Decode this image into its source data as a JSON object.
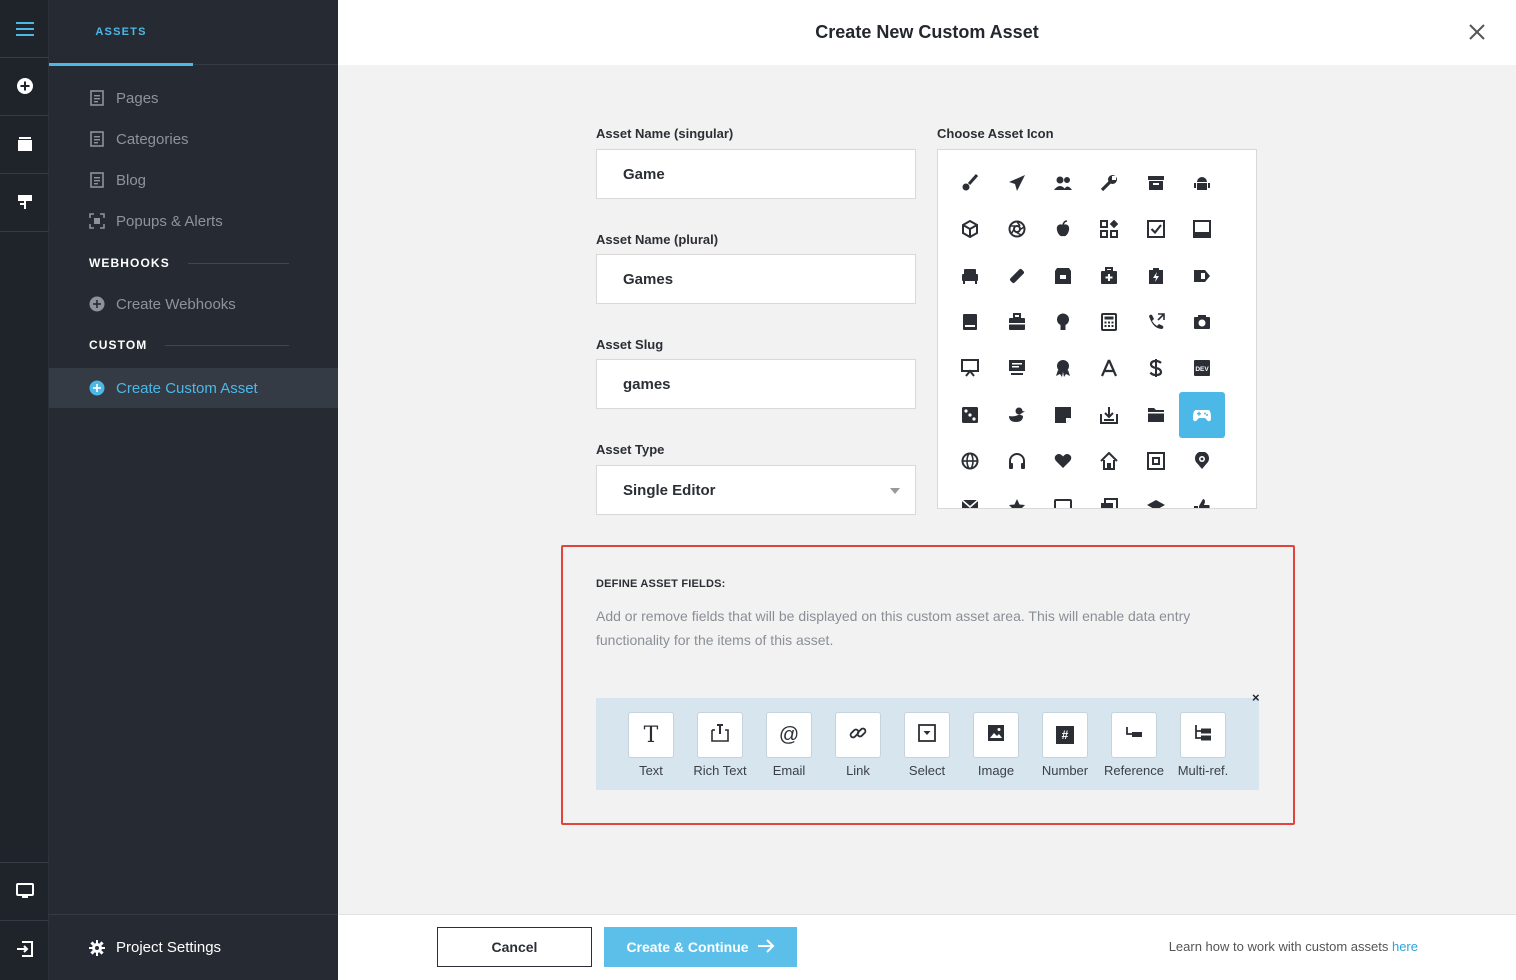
{
  "rail": {
    "icons": [
      "hamburger-icon",
      "plus-circle-icon",
      "window-icon",
      "flag-icon",
      "monitor-icon",
      "logout-icon"
    ]
  },
  "sidebar": {
    "tab_label": "ASSETS",
    "items": [
      {
        "label": "Pages",
        "icon": "page-icon"
      },
      {
        "label": "Categories",
        "icon": "page-icon"
      },
      {
        "label": "Blog",
        "icon": "page-icon"
      },
      {
        "label": "Popups & Alerts",
        "icon": "popup-icon"
      }
    ],
    "webhooks_section": "WEBHOOKS",
    "webhooks_item": "Create Webhooks",
    "custom_section": "CUSTOM",
    "custom_item": "Create Custom Asset",
    "footer_label": "Project Settings"
  },
  "modal": {
    "title": "Create New Custom Asset",
    "name_singular_label": "Asset Name (singular)",
    "name_singular_value": "Game",
    "name_plural_label": "Asset Name (plural)",
    "name_plural_value": "Games",
    "slug_label": "Asset Slug",
    "slug_value": "games",
    "type_label": "Asset Type",
    "type_value": "Single Editor",
    "icon_label": "Choose Asset Icon",
    "selected_icon": "gamepad-icon",
    "accent_color": "#4cb8e8"
  },
  "define": {
    "title": "DEFINE ASSET FIELDS:",
    "description": "Add or remove fields that will be displayed on this custom asset area. This will enable data entry functionality for the items of this asset.",
    "close_glyph": "×",
    "field_types": [
      {
        "label": "Text",
        "glyph": "T"
      },
      {
        "label": "Rich Text",
        "glyph": ""
      },
      {
        "label": "Email",
        "glyph": "@"
      },
      {
        "label": "Link",
        "glyph": ""
      },
      {
        "label": "Select",
        "glyph": ""
      },
      {
        "label": "Image",
        "glyph": ""
      },
      {
        "label": "Number",
        "glyph": "#"
      },
      {
        "label": "Reference",
        "glyph": ""
      },
      {
        "label": "Multi-ref.",
        "glyph": ""
      }
    ]
  },
  "footer": {
    "cancel_label": "Cancel",
    "create_label": "Create & Continue",
    "learn_text": "Learn how to work with custom assets",
    "learn_link": "here"
  }
}
